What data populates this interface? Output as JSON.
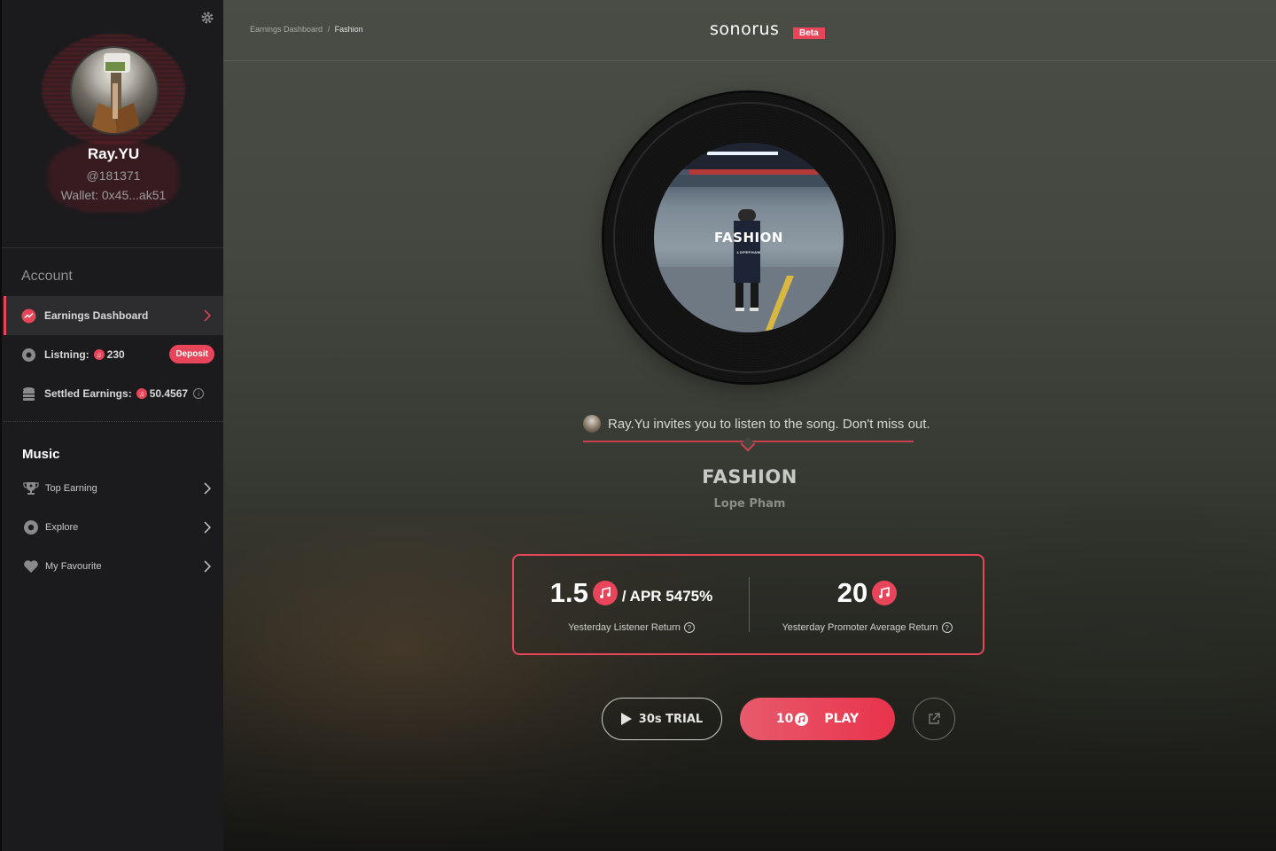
{
  "sidebar": {
    "user": {
      "name": "Ray.YU",
      "handle": "@181371",
      "wallet": "Wallet: 0x45...ak51"
    },
    "account_heading": "Account",
    "account_items": [
      {
        "label": "Earnings Dashboard",
        "icon": "trend-icon",
        "active": true
      },
      {
        "label": "Listning:",
        "icon": "disc-icon",
        "value": "230",
        "action": "Deposit"
      },
      {
        "label": "Settled Earnings:",
        "icon": "coins-icon",
        "value": "50.4567"
      }
    ],
    "music_heading": "Music",
    "music_items": [
      {
        "label": "Top Earning",
        "icon": "trophy-icon"
      },
      {
        "label": "Explore",
        "icon": "disc-icon"
      },
      {
        "label": "My Favourite",
        "icon": "heart-icon"
      }
    ]
  },
  "header": {
    "breadcrumb": [
      "Earnings Dashboard",
      "/",
      "Fashion"
    ],
    "logo": "sonorus",
    "badge": "Beta"
  },
  "album": {
    "title": "FASHION",
    "subtitle": "LOPEPHAM"
  },
  "invite_text": "Ray.Yu invites you to listen to the song. Don't miss out.",
  "song": {
    "title": "FASHION",
    "artist": "Lope Pham"
  },
  "stats": {
    "listener": {
      "value": "1.5",
      "apr": "/ APR 5475%",
      "label": "Yesterday Listener Return"
    },
    "promoter": {
      "value": "20",
      "label": "Yesterday Promoter Average Return"
    }
  },
  "actions": {
    "trial": "30s TRIAL",
    "play_cost": "10",
    "play": "PLAY"
  },
  "colors": {
    "accent": "#e8445a",
    "sidebar_bg": "#1b1b1d",
    "main_bg": "#43473f"
  }
}
